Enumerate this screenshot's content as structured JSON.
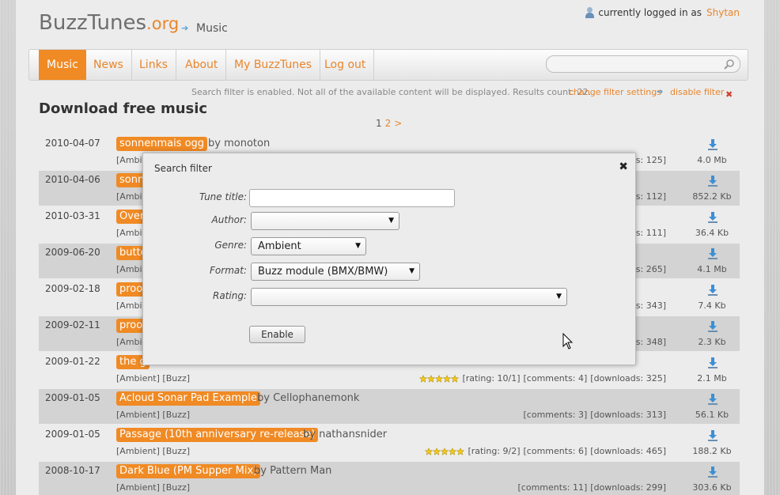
{
  "header": {
    "logo_main": "BuzzTunes",
    "logo_tld": ".org",
    "breadcrumb": "Music",
    "login_text": "currently logged in as",
    "username": "Shytan"
  },
  "nav": {
    "items": [
      "Music",
      "News",
      "Links",
      "About",
      "My BuzzTunes",
      "Log out"
    ],
    "active": "Music",
    "search_placeholder": ""
  },
  "filter_bar": {
    "message": "Search filter is enabled. Not all of the available content will be displayed. Results count: 22.",
    "change_link": "change filter settings",
    "disable_link": "disable filter"
  },
  "page_title": "Download free music",
  "pager": {
    "current": "1",
    "next_page": "2",
    "next": ">"
  },
  "tunes": [
    {
      "date": "2010-04-07",
      "title": "sonnenmais ogg",
      "author": "monoton",
      "tags": "[Ambient]",
      "stats": "[downloads: 125]",
      "size": "4.0 Mb"
    },
    {
      "date": "2010-04-06",
      "title": "sonn",
      "author": "",
      "tags": "[Ambie",
      "stats": "[downloads: 112]",
      "size": "852.2 Kb"
    },
    {
      "date": "2010-03-31",
      "title": "Over",
      "author": "",
      "tags": "[Ambie",
      "stats": "[downloads: 111]",
      "size": "36.4 Kb"
    },
    {
      "date": "2009-06-20",
      "title": "butte",
      "author": "",
      "tags": "[Ambie",
      "stats": "[downloads: 265]",
      "size": "4.1 Mb"
    },
    {
      "date": "2009-02-18",
      "title": "proo",
      "author": "",
      "tags": "[Ambie",
      "stats": "[downloads: 343]",
      "size": "7.4 Kb"
    },
    {
      "date": "2009-02-11",
      "title": "proo",
      "author": "",
      "tags": "[Ambie",
      "stats": "[downloads: 348]",
      "size": "2.3 Kb"
    },
    {
      "date": "2009-01-22",
      "title": "the g",
      "author": "",
      "tags": "[Ambient] [Buzz]",
      "rating": "[rating: 10/1]",
      "comments": "[comments: 4]",
      "stats": "[downloads: 325]",
      "size": "2.1 Mb",
      "stars": 5
    },
    {
      "date": "2009-01-05",
      "title": "Acloud Sonar Pad Example",
      "author": "Cellophanemonk",
      "tags": "[Ambient] [Buzz]",
      "comments": "[comments: 3]",
      "stats": "[downloads: 313]",
      "size": "56.1 Kb"
    },
    {
      "date": "2009-01-05",
      "title": "Passage (10th anniversary re-release)",
      "author": "nathansnider",
      "tags": "[Ambient] [Buzz]",
      "rating": "[rating: 9/2]",
      "comments": "[comments: 6]",
      "stats": "[downloads: 465]",
      "size": "188.2 Kb",
      "stars": 5
    },
    {
      "date": "2008-10-17",
      "title": "Dark Blue (PM Supper Mix)",
      "author": "Pattern Man",
      "tags": "[Ambient] [Buzz]",
      "comments": "[comments: 11]",
      "stats": "[downloads: 299]",
      "size": "303.6 Kb"
    }
  ],
  "by_word": "by",
  "modal": {
    "title": "Search filter",
    "fields": {
      "tune_title_label": "Tune title:",
      "tune_title_value": "",
      "author_label": "Author:",
      "author_value": "",
      "genre_label": "Genre:",
      "genre_value": "Ambient",
      "format_label": "Format:",
      "format_value": "Buzz module (BMX/BMW)",
      "rating_label": "Rating:",
      "rating_value": ""
    },
    "enable_label": "Enable"
  },
  "colors": {
    "accent": "#f08a24",
    "link": "#e8862c",
    "arrow": "#5b9ed6"
  }
}
